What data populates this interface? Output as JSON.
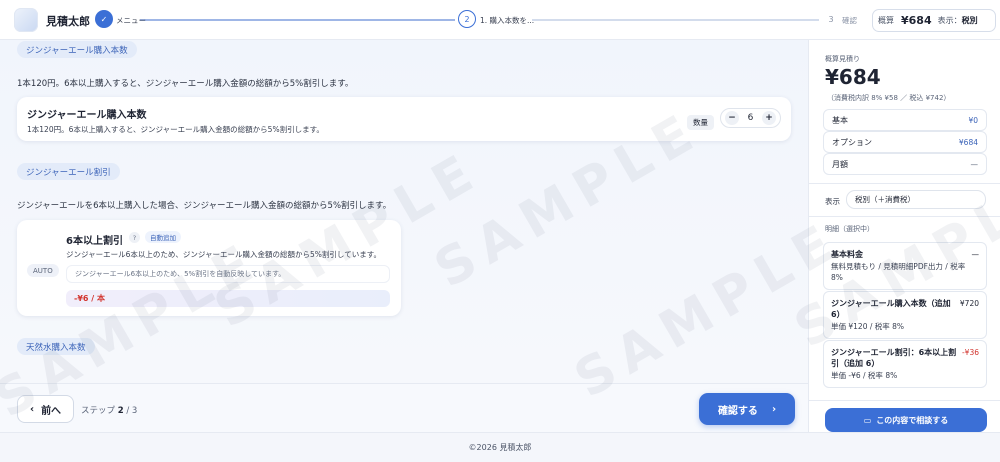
{
  "header": {
    "brand": "見積太郎",
    "steps": [
      {
        "num": "✓",
        "label": "メニュー"
      },
      {
        "num": "2",
        "label": "1. 購入本数を..."
      },
      {
        "num": "3",
        "label": "確認"
      }
    ],
    "summary_label": "概算",
    "summary_amount": "¥684",
    "summary_tax_label": "表示：",
    "summary_tax_value": "税別"
  },
  "main": {
    "section1_chip": "ジンジャーエール購入本数",
    "section1_desc": "1本120円。6本以上購入すると、ジンジャーエール購入金額の総額から5%割引します。",
    "card1_title": "ジンジャーエール購入本数",
    "card1_sub": "1本120円。6本以上購入すると、ジンジャーエール購入金額の総額から5%割引します。",
    "qty_label": "数量",
    "minus": "−",
    "qty_value": "6",
    "plus": "+",
    "section2_chip": "ジンジャーエール割引",
    "section2_desc": "ジンジャーエールを6本以上購入した場合、ジンジャーエール購入金額の総額から5%割引します。",
    "card2_badge": "AUTO",
    "card2_title": "6本以上割引",
    "card2_help": "?",
    "card2_autoadd": "自動追加",
    "card2_sub": "ジンジャーエール6本以上のため、ジンジャーエール購入金額の総額から5%割引しています。",
    "card2_note": "ジンジャーエール6本以上のため、5%割引を自動反映しています。",
    "card2_price": "-¥6 / 本",
    "section3_chip": "天然水購入本数"
  },
  "actions": {
    "prev_label": "前へ",
    "step_prefix": "ステップ",
    "step_current": "2",
    "step_total": "/ 3",
    "next_label": "確認する"
  },
  "footer": {
    "copyright": "©2026 見積太郎"
  },
  "sidebar": {
    "title": "概算見積り",
    "amount": "¥684",
    "tax_line": "（消費税内訳 8% ¥58 ／ 税込 ¥742）",
    "rows": [
      {
        "label": "基本",
        "value": "¥0"
      },
      {
        "label": "オプション",
        "value": "¥684"
      },
      {
        "label": "月額",
        "value": "—"
      }
    ],
    "display_label": "表示",
    "display_value": "税別（＋消費税）",
    "detail_title": "明細（選択中）",
    "items": [
      {
        "name": "基本料金",
        "amount": "—",
        "sub": "無料見積もり / 見積明細PDF出力 / 税率 8%"
      },
      {
        "name": "ジンジャーエール購入本数（追加 6）",
        "amount": "¥720",
        "sub": "単価 ¥120 / 税率 8%"
      },
      {
        "name": "ジンジャーエール割引：6本以上割引（追加 6）",
        "amount": "-¥36",
        "sub": "単価 -¥6 / 税率 8%"
      }
    ],
    "consult_label": "この内容で相談する"
  },
  "watermark": {
    "text": "SAMPLE"
  },
  "colors": {
    "accent": "#3b6fd6",
    "negative": "#d2342e",
    "chip_bg": "#e3ebf9"
  }
}
